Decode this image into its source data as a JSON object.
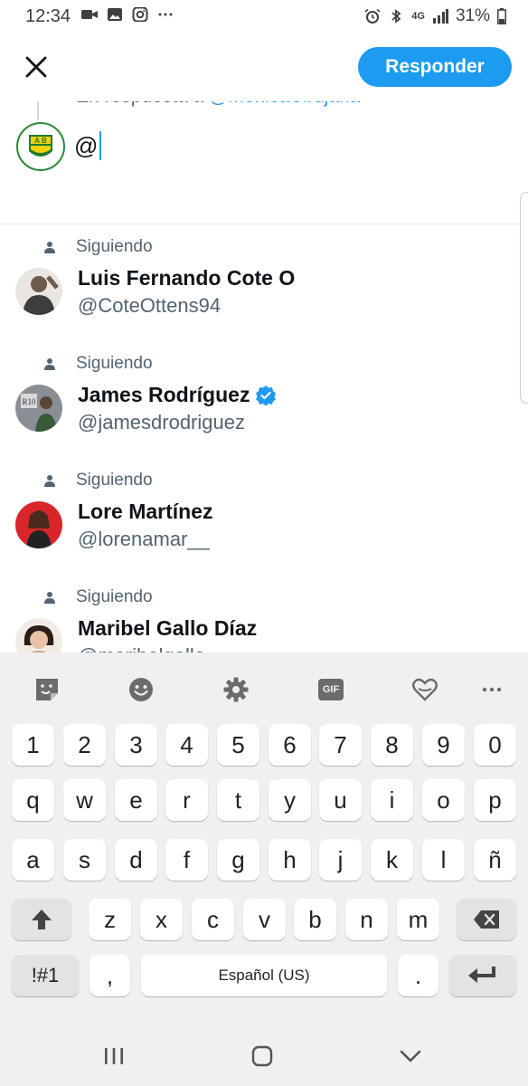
{
  "status_bar": {
    "time": "12:34",
    "battery": "31%",
    "network": "4G"
  },
  "header": {
    "close_icon": "close-icon",
    "reply_button": "Responder"
  },
  "compose": {
    "reply_prefix": "En respuesta a",
    "reply_handle": "@MonicaCirujana",
    "input_value": "@"
  },
  "suggestions": [
    {
      "relation": "Siguiendo",
      "name": "Luis Fernando Cote O",
      "handle": "@CoteOttens94",
      "verified": false,
      "avatar_color": "#6b5a4e"
    },
    {
      "relation": "Siguiendo",
      "name": "James Rodríguez",
      "handle": "@jamesdrodriguez",
      "verified": true,
      "avatar_color": "#8a8f96"
    },
    {
      "relation": "Siguiendo",
      "name": "Lore Martínez",
      "handle": "@lorenamar__",
      "verified": false,
      "avatar_color": "#d8262a"
    },
    {
      "relation": "Siguiendo",
      "name": "Maribel Gallo Díaz",
      "handle": "@maribelgallo",
      "verified": false,
      "avatar_color": "#c9a48a"
    }
  ],
  "keyboard": {
    "toolbar": [
      "sticker-icon",
      "emoji-icon",
      "settings-icon",
      "GIF",
      "heart-sticker-icon",
      "more-icon"
    ],
    "row_numbers": [
      "1",
      "2",
      "3",
      "4",
      "5",
      "6",
      "7",
      "8",
      "9",
      "0"
    ],
    "row_1": [
      "q",
      "w",
      "e",
      "r",
      "t",
      "y",
      "u",
      "i",
      "o",
      "p"
    ],
    "row_2": [
      "a",
      "s",
      "d",
      "f",
      "g",
      "h",
      "j",
      "k",
      "l",
      "ñ"
    ],
    "row_3": [
      "z",
      "x",
      "c",
      "v",
      "b",
      "n",
      "m"
    ],
    "symbols_key": "!#1",
    "comma_key": ",",
    "space_label": "Español (US)",
    "period_key": "."
  },
  "colors": {
    "accent": "#1d9bf0",
    "text_primary": "#0f1419",
    "text_secondary": "#536471",
    "keyboard_bg": "#f0f0f0"
  }
}
